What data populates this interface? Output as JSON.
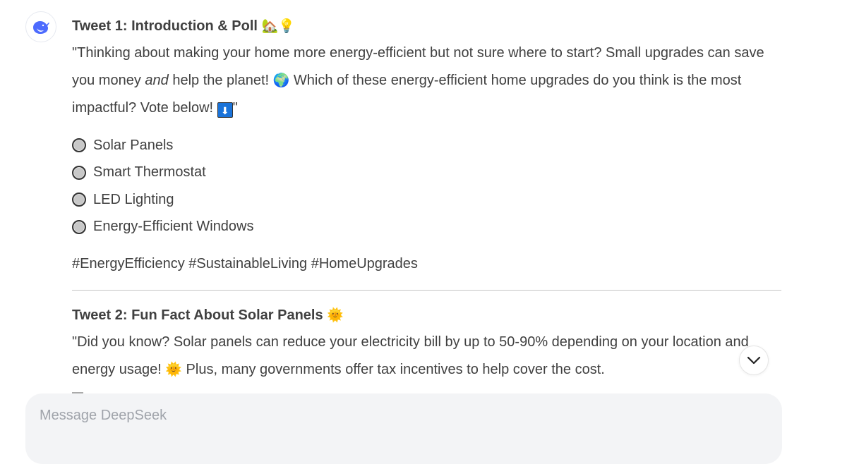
{
  "assistant": {
    "name": "DeepSeek",
    "avatar_icon": "deepseek-whale-icon",
    "brand_color": "#4d6bfe"
  },
  "tweet1": {
    "heading": "Tweet 1: Introduction & Poll",
    "heading_emoji": "🏡💡",
    "para_part1": "\"Thinking about making your home more energy-efficient but not sure where to start? Small upgrades can save you money ",
    "para_em": "and",
    "para_part2": " help the planet! ",
    "globe_emoji": "🌍",
    "para_part3": " Which of these energy-efficient home upgrades do you think is the most impactful? Vote below! ",
    "arrow_emoji": "⬇",
    "para_end": "\"",
    "poll_options": [
      {
        "label": "Solar Panels"
      },
      {
        "label": "Smart Thermostat"
      },
      {
        "label": "LED Lighting"
      },
      {
        "label": "Energy-Efficient Windows"
      }
    ],
    "hashtags": "#EnergyEfficiency #SustainableLiving #HomeUpgrades"
  },
  "tweet2": {
    "heading": "Tweet 2: Fun Fact About Solar Panels",
    "heading_emoji": "🌞",
    "para_part1": "\"Did you know? Solar panels can reduce your electricity bill by up to 50-90% depending on your location and energy usage! ",
    "sun_emoji": "🌞",
    "para_part2": " Plus, many governments offer tax incentives to help cover the cost."
  },
  "composer": {
    "placeholder": "Message DeepSeek"
  },
  "scroll_button": {
    "icon": "chevron-down-icon"
  }
}
